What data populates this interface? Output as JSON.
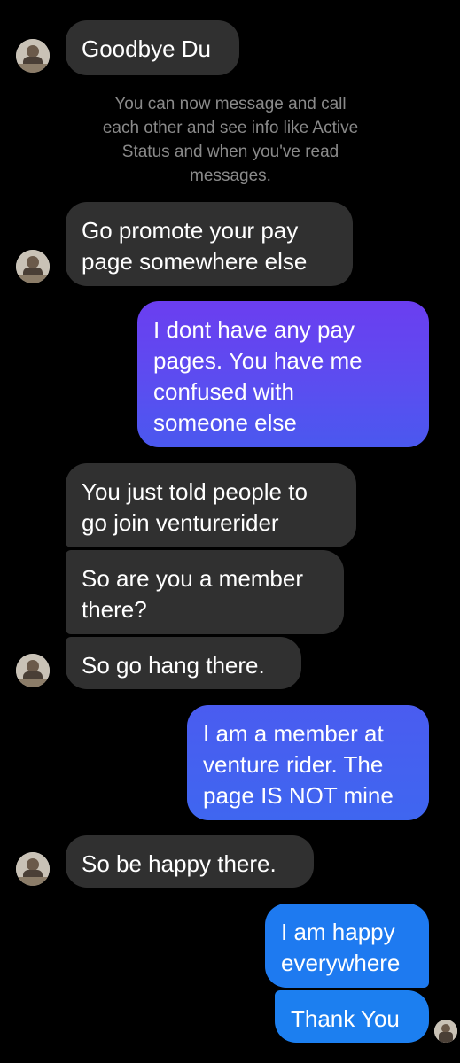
{
  "system_notice": "You can now message and call\neach other and see info like Active\nStatus and when you've read\nmessages.",
  "messages": [
    {
      "sender": "them",
      "text": "Goodbye Du"
    },
    {
      "sender": "them",
      "text": "Go promote your pay\npage somewhere else"
    },
    {
      "sender": "me",
      "text": "I dont have any pay\npages.  You have me\nconfused with\nsomeone else"
    },
    {
      "sender": "them",
      "text": "You just told people to\ngo join venturerider"
    },
    {
      "sender": "them",
      "text": "So are you a member\nthere?"
    },
    {
      "sender": "them",
      "text": "So go hang there."
    },
    {
      "sender": "me",
      "text": "I am a member at\nventure rider.  The\npage IS NOT mine"
    },
    {
      "sender": "them",
      "text": "So be happy there."
    },
    {
      "sender": "me",
      "text": "I am happy\neverywhere"
    },
    {
      "sender": "me",
      "text": "Thank You"
    }
  ],
  "avatars": {
    "contact_icon": "contact-avatar-icon",
    "read_receipt_icon": "read-receipt-avatar-icon"
  },
  "colors": {
    "background": "#000000",
    "incoming_bubble": "#303030",
    "outgoing_gradient_top": "#6b3ef0",
    "outgoing_gradient_bottom": "#1a7bf0",
    "system_text": "#8a8a8a"
  }
}
